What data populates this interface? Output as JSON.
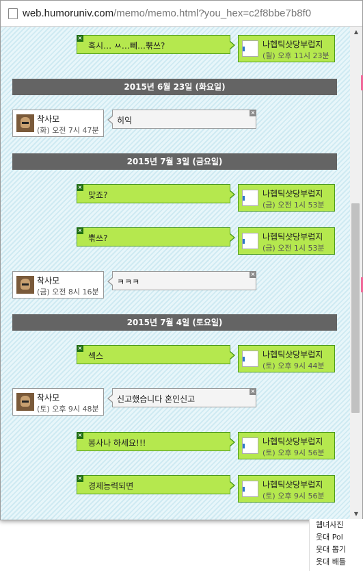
{
  "url": {
    "host": "web.humoruniv.com",
    "path": "/memo/memo.html?you_hex=c2f8bbe7b8f0"
  },
  "users": {
    "me": {
      "name": "나헵틱샷당부럽지"
    },
    "other": {
      "name": "착사모"
    }
  },
  "close_glyph": "×",
  "messages": [
    {
      "type": "sent",
      "text": "혹시… ㅆ…뻬…뿎쓰?",
      "time": "(월) 오후 11시 23분"
    },
    {
      "type": "date",
      "text": "2015년 6월 23일 (화요일)"
    },
    {
      "type": "received",
      "text": "히익",
      "time": "(화) 오전 7시 47분"
    },
    {
      "type": "date",
      "text": "2015년 7월 3일 (금요일)"
    },
    {
      "type": "sent",
      "text": "맞죠?",
      "time": "(금) 오전 1시 53분"
    },
    {
      "type": "sent",
      "text": "뿎쓰?",
      "time": "(금) 오전 1시 53분"
    },
    {
      "type": "received",
      "text": "ㅋㅋㅋ",
      "time": "(금) 오전 8시 16분"
    },
    {
      "type": "date",
      "text": "2015년 7월 4일 (토요일)"
    },
    {
      "type": "sent",
      "text": "섹스",
      "time": "(토) 오후 9시 44분"
    },
    {
      "type": "received",
      "text": "신고했습니다 혼인신고",
      "time": "(토) 오후 9시 48분"
    },
    {
      "type": "sent",
      "text": "봉사나 하세요!!!",
      "time": "(토) 오후 9시 56분"
    },
    {
      "type": "sent",
      "text": "경제능력되면",
      "time": "(토) 오후 9시 56분"
    }
  ],
  "background_links": [
    "웹녀사진",
    "웃대 Pol",
    "웃대 뽑기",
    "웃대 배틀"
  ],
  "colors": {
    "sent_bg": "#b5e84e",
    "sent_border": "#4b9a1a",
    "date_bar": "#646464",
    "received_bg": "#f4f4f4"
  }
}
